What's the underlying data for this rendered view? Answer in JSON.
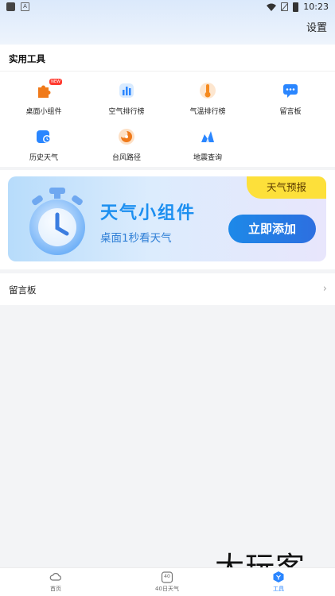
{
  "status_bar": {
    "time": "10:23"
  },
  "header": {
    "settings_label": "设置"
  },
  "tools": {
    "title": "实用工具",
    "items": [
      {
        "label": "桌面小组件",
        "icon": "puzzle-icon",
        "color": "#f07a1a",
        "badge": "NEW"
      },
      {
        "label": "空气排行榜",
        "icon": "bar-chart-icon",
        "color": "#2a86ff"
      },
      {
        "label": "气温排行榜",
        "icon": "thermometer-icon",
        "color": "#f58a1f"
      },
      {
        "label": "留言板",
        "icon": "message-board-icon",
        "color": "#2a86ff"
      },
      {
        "label": "历史天气",
        "icon": "history-weather-icon",
        "color": "#2a86ff"
      },
      {
        "label": "台风路径",
        "icon": "typhoon-icon",
        "color": "#f07a1a"
      },
      {
        "label": "地震查询",
        "icon": "earthquake-icon",
        "color": "#2a86ff"
      }
    ]
  },
  "banner": {
    "tag": "天气预报",
    "title": "天气小组件",
    "subtitle": "桌面1秒看天气",
    "button": "立即添加"
  },
  "message_row": {
    "label": "留言板",
    "chevron": "›"
  },
  "bottom_nav": {
    "items": [
      {
        "label": "首页",
        "icon": "home-cloud-icon",
        "active": false
      },
      {
        "label": "40日天气",
        "icon": "calendar-40-icon",
        "active": false,
        "icon_text": "40"
      },
      {
        "label": "工具",
        "icon": "tools-icon",
        "active": true
      }
    ]
  },
  "watermark": "大玩客"
}
